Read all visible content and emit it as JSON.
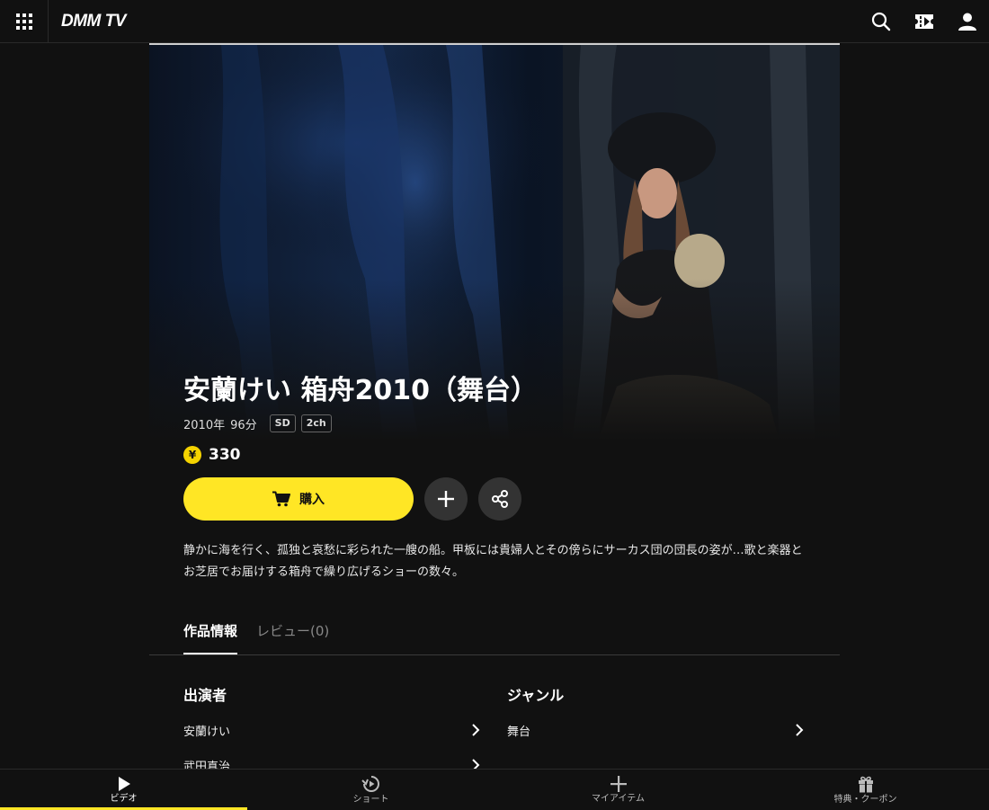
{
  "header": {
    "logo": "DMM TV",
    "icons": [
      "grid-menu-icon",
      "search-icon",
      "ticket-icon",
      "user-icon"
    ]
  },
  "content": {
    "title": "安蘭けい 箱舟2010（舞台）",
    "year": "2010年",
    "duration": "96分",
    "badges": [
      "SD",
      "2ch"
    ],
    "price_symbol": "¥",
    "price": "330",
    "buy_label": "購入",
    "description": "静かに海を行く、孤独と哀愁に彩られた一艘の船。甲板には貴婦人とその傍らにサーカス団の団長の姿が…歌と楽器とお芝居でお届けする箱舟で繰り広げるショーの数々。"
  },
  "tabs": [
    {
      "label": "作品情報",
      "active": true
    },
    {
      "label": "レビュー(0)",
      "active": false
    }
  ],
  "info": {
    "cast_title": "出演者",
    "cast": [
      "安蘭けい",
      "武田真治"
    ],
    "genre_title": "ジャンル",
    "genres": [
      "舞台"
    ]
  },
  "bottom_nav": [
    {
      "label": "ビデオ",
      "icon": "play-icon",
      "active": true
    },
    {
      "label": "ショート",
      "icon": "short-play-icon",
      "active": false
    },
    {
      "label": "マイアイテム",
      "icon": "plus-icon",
      "active": false
    },
    {
      "label": "特典・クーポン",
      "icon": "gift-icon",
      "active": false
    }
  ],
  "colors": {
    "accent": "#ffe625",
    "background": "#111111"
  }
}
